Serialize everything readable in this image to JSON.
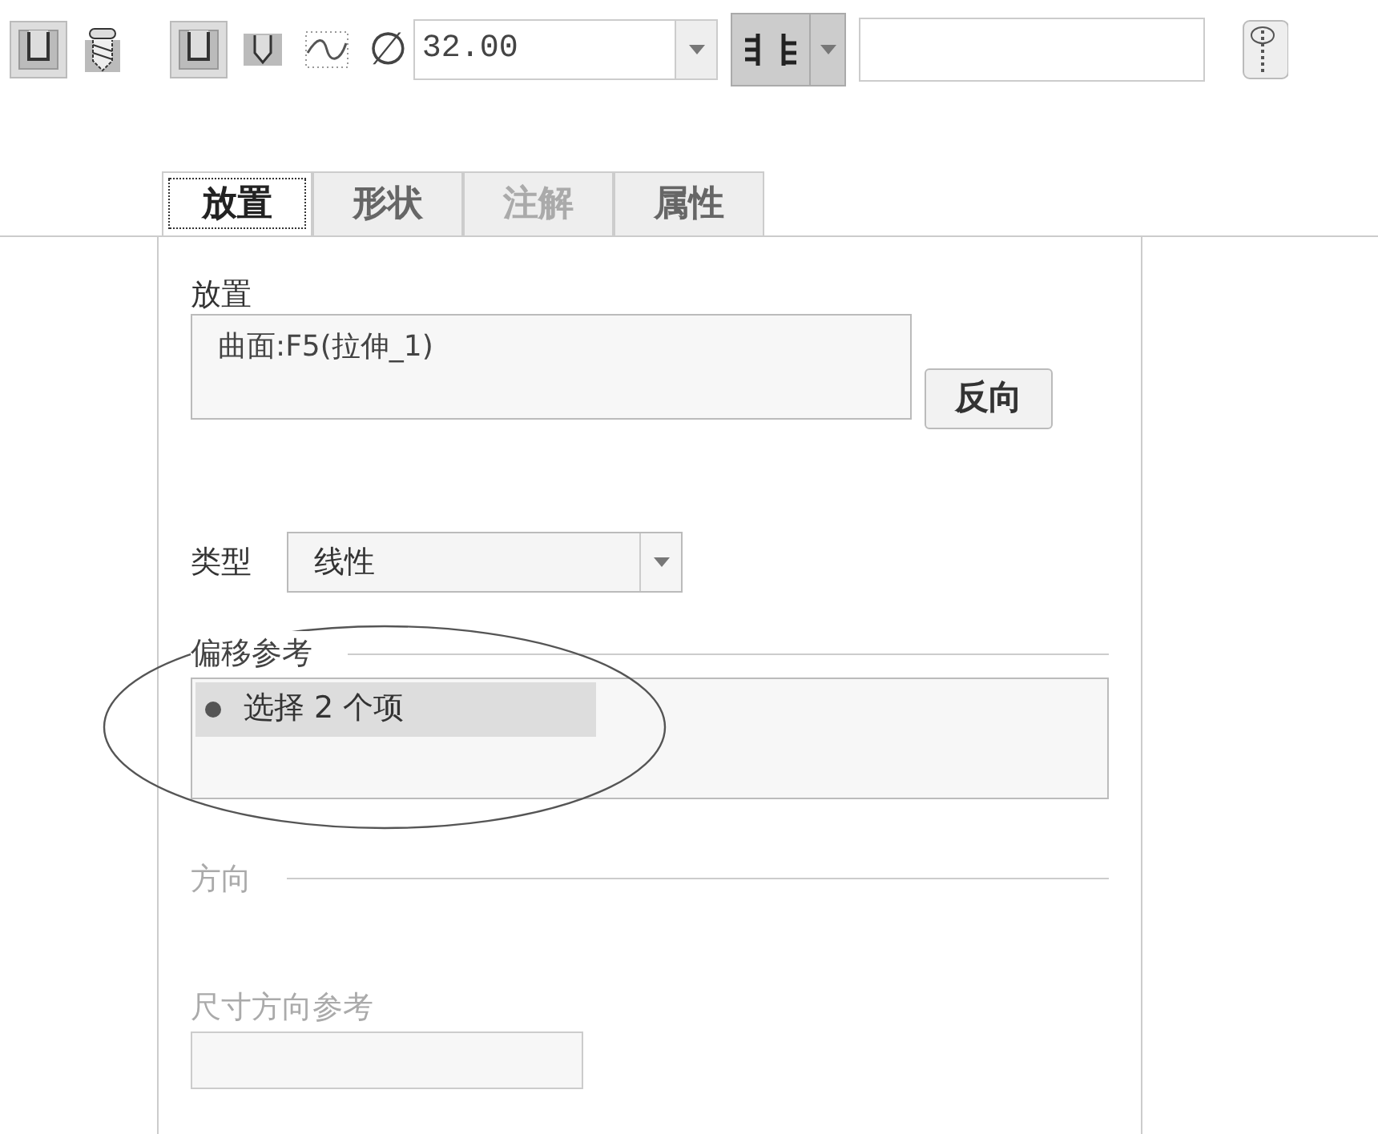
{
  "toolbar": {
    "buttons": [
      {
        "kind": "flat",
        "selected": true
      },
      {
        "kind": "counterbore",
        "selected": false
      },
      {
        "kind": "flat",
        "selected": true
      },
      {
        "kind": "drill",
        "selected": false
      },
      {
        "kind": "sketch",
        "selected": false
      }
    ],
    "diameter": {
      "symbol": "∅",
      "value": "32.00"
    },
    "depth": {
      "selected": true
    }
  },
  "tabs": [
    {
      "label": "放置",
      "selected": true,
      "disabled": false
    },
    {
      "label": "形状",
      "selected": false,
      "disabled": false
    },
    {
      "label": "注解",
      "selected": false,
      "disabled": true
    },
    {
      "label": "属性",
      "selected": false,
      "disabled": false
    }
  ],
  "placement": {
    "label": "放置",
    "reference": "曲面:F5(拉伸_1)",
    "button": "反向"
  },
  "type": {
    "label": "类型",
    "value": "线性"
  },
  "offset_references": {
    "label": "偏移参考",
    "items": [
      {
        "text": "选择 2 个项",
        "selected": true
      }
    ]
  },
  "direction": {
    "label": "方向",
    "disabled": true
  },
  "dimension_reference": {
    "label": "尺寸方向参考",
    "disabled": true
  }
}
